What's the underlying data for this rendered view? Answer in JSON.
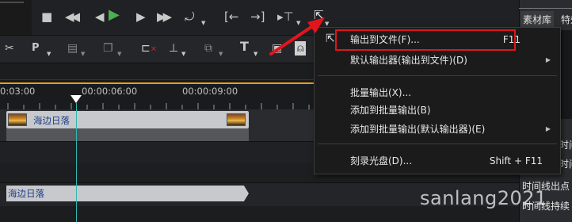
{
  "colors": {
    "accent_red": "#e0161c",
    "play_green": "#4caf50",
    "playhead": "#ffffff",
    "ruler_orange": "#e8a020"
  },
  "ruler": {
    "ticks": [
      "0:03:00",
      "00:00:06:00",
      "00:00:09:00"
    ]
  },
  "tracks": {
    "clip1_label": "海边日落",
    "clip2_label": "海边日落"
  },
  "right_panel": {
    "tab_library": "素材库",
    "tab_effects": "特效",
    "label_1": "时间",
    "label_2": "时间",
    "label_3": "时间线出点",
    "label_4": "时间线持续"
  },
  "menu": {
    "items": [
      {
        "label": "输出到文件(F)...",
        "shortcut": "F11",
        "submenu": false
      },
      {
        "label": "默认输出器(输出到文件)(D)",
        "shortcut": "",
        "submenu": true
      },
      {
        "label": "批量输出(X)...",
        "shortcut": "",
        "submenu": false
      },
      {
        "label": "添加到批量输出(B)",
        "shortcut": "",
        "submenu": false
      },
      {
        "label": "添加到批量输出(默认输出器)(E)",
        "shortcut": "",
        "submenu": true
      },
      {
        "label": "刻录光盘(D)...",
        "shortcut": "Shift + F11",
        "submenu": false
      }
    ]
  },
  "toolbar2": {
    "preset_label": "P"
  },
  "watermark": "sanlang2021"
}
